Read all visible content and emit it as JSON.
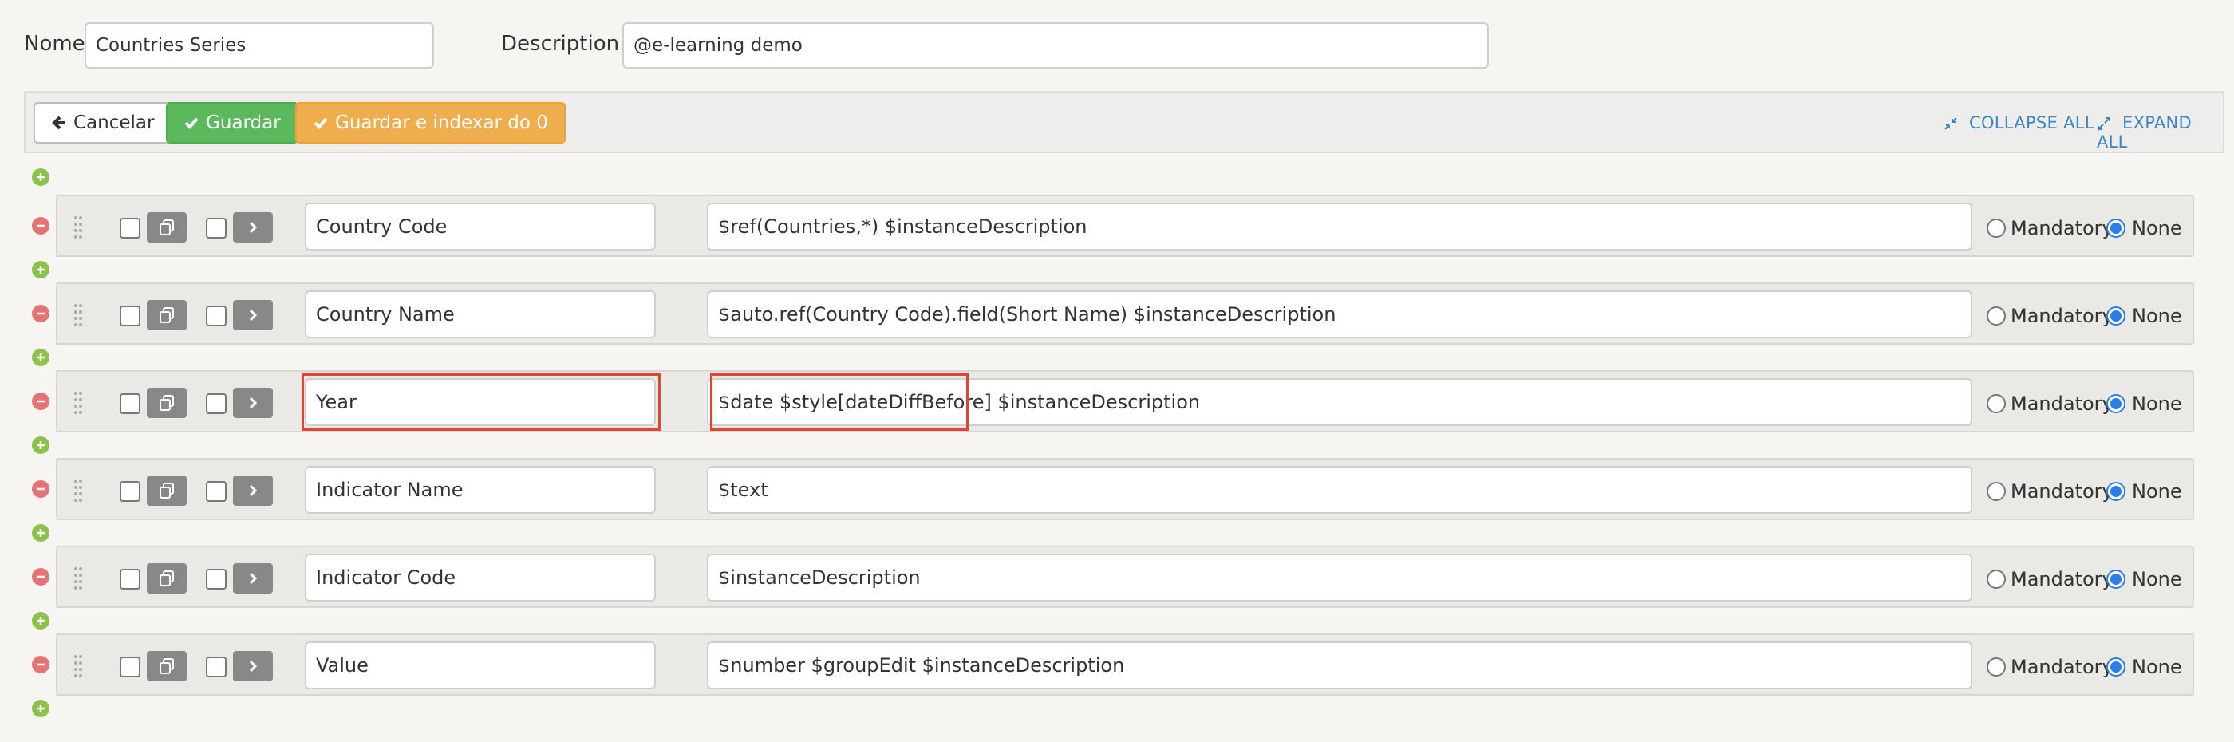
{
  "header": {
    "name_label": "Nome",
    "name_value": "Countries Series",
    "description_label": "Description:",
    "description_value": "@e-learning demo"
  },
  "toolbar": {
    "cancel_label": "Cancelar",
    "save_label": "Guardar",
    "save_index_label": "Guardar e indexar do 0",
    "collapse_label": "COLLAPSE ALL",
    "expand_label": "EXPAND ALL"
  },
  "fields": [
    {
      "name": "Country Code",
      "definition": "$ref(Countries,*)  $instanceDescription",
      "mandatory": false,
      "none": true
    },
    {
      "name": "Country Name",
      "definition": "$auto.ref(Country Code).field(Short Name) $instanceDescription",
      "mandatory": false,
      "none": true
    },
    {
      "name": "Year",
      "definition": "$date $style[dateDiffBefore] $instanceDescription",
      "mandatory": false,
      "none": true
    },
    {
      "name": "Indicator Name",
      "definition": "$text",
      "mandatory": false,
      "none": true
    },
    {
      "name": "Indicator Code",
      "definition": "$instanceDescription",
      "mandatory": false,
      "none": true
    },
    {
      "name": "Value",
      "definition": "$number $groupEdit $instanceDescription",
      "mandatory": false,
      "none": true
    }
  ],
  "radio_labels": {
    "mandatory": "Mandatory",
    "none": "None"
  },
  "colors": {
    "success": "#5cb85c",
    "warning": "#f0ad4e",
    "link": "#3a88c8",
    "add": "#8bc34a",
    "remove": "#e57373",
    "highlight": "#e0452d",
    "radio_selected": "#2b7de9"
  },
  "icons": {
    "cancel": "arrow-left-icon",
    "save": "check-icon",
    "collapse": "compress-icon",
    "expand": "expand-icon",
    "add": "plus-circle-icon",
    "remove": "minus-circle-icon",
    "drag": "drag-handle-icon",
    "duplicate": "copy-icon",
    "open": "chevron-right-icon"
  }
}
